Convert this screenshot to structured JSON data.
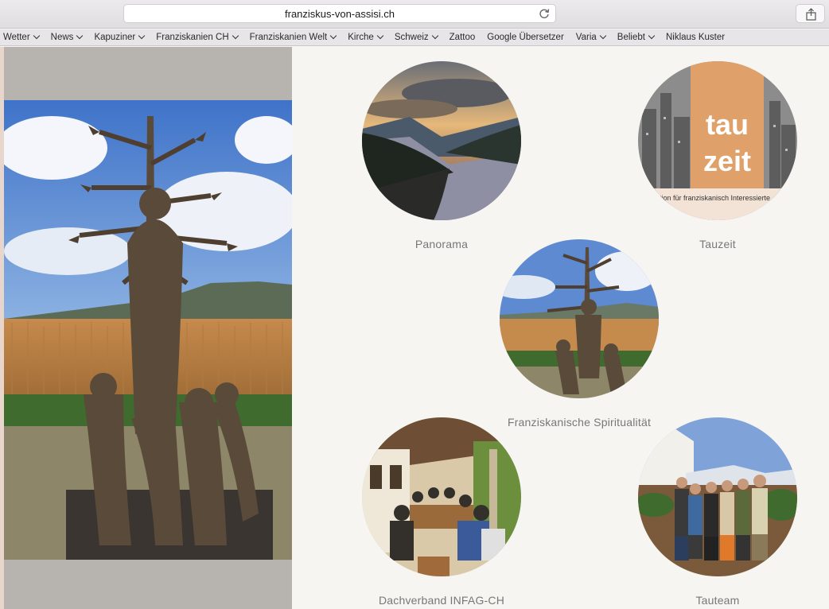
{
  "browser": {
    "url": "franziskus-von-assisi.ch",
    "bookmarks": [
      {
        "label": "Wetter",
        "menu": true
      },
      {
        "label": "News",
        "menu": true
      },
      {
        "label": "Kapuziner",
        "menu": true
      },
      {
        "label": "Franziskanien CH",
        "menu": true
      },
      {
        "label": "Franziskanien Welt",
        "menu": true
      },
      {
        "label": "Kirche",
        "menu": true
      },
      {
        "label": "Schweiz",
        "menu": true
      },
      {
        "label": "Zattoo",
        "menu": false
      },
      {
        "label": "Google Übersetzer",
        "menu": false
      },
      {
        "label": "Varia",
        "menu": true
      },
      {
        "label": "Beliebt",
        "menu": true
      },
      {
        "label": "Niklaus Kuster",
        "menu": false
      }
    ]
  },
  "tiles": [
    {
      "id": "panorama",
      "caption": "Panorama"
    },
    {
      "id": "tauzeit",
      "caption": "Tauzeit",
      "logo_top": "tau",
      "logo_bottom": "zeit",
      "strip_text": "ation für franziskanisch Interessierte"
    },
    {
      "id": "spiritualitaet",
      "caption": "Franziskanische Spiritualität"
    },
    {
      "id": "infag",
      "caption": "Dachverband INFAG-CH"
    },
    {
      "id": "tauteam",
      "caption": "Tauteam"
    }
  ],
  "colors": {
    "left_column": "#b7b3ae",
    "page_background": "#f7f5f1",
    "tauzeit_orange": "#e0a06a"
  }
}
